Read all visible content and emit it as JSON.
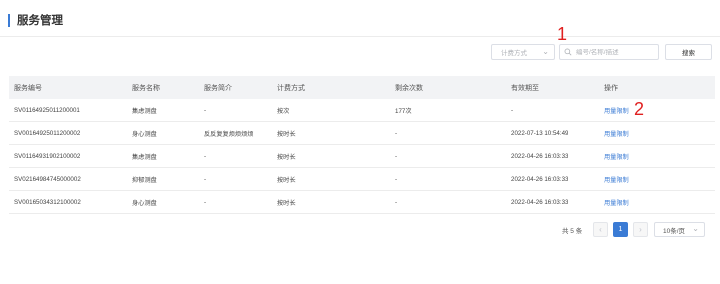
{
  "page": {
    "title": "服务管理"
  },
  "toolbar": {
    "billing_select": "计费方式",
    "search_placeholder": "编号/名称/描述",
    "search_button": "搜索"
  },
  "markers": [
    "1",
    "2"
  ],
  "table": {
    "headers": [
      "服务编号",
      "服务名称",
      "服务简介",
      "计费方式",
      "剩余次数",
      "有效期至",
      "操作"
    ],
    "rows": [
      [
        "SV01164925011200001",
        "集虑测盘",
        "-",
        "按次",
        "177次",
        "-",
        "用量限制"
      ],
      [
        "SV00164925011200002",
        "身心测盘",
        "反反复复烦烦烦烦",
        "按时长",
        "-",
        "2022-07-13 10:54:49",
        "用量限制"
      ],
      [
        "SV01164931902100002",
        "集虑测盘",
        "-",
        "按时长",
        "-",
        "2022-04-26 16:03:33",
        "用量限制"
      ],
      [
        "SV02164984745000002",
        "抑郁测盘",
        "-",
        "按时长",
        "-",
        "2022-04-26 16:03:33",
        "用量限制"
      ],
      [
        "SV00165034312100002",
        "身心测盘",
        "-",
        "按时长",
        "-",
        "2022-04-26 16:03:33",
        "用量限制"
      ]
    ]
  },
  "pagination": {
    "total": "共 5 条",
    "current_page": "1",
    "page_size": "10条/页"
  },
  "colors": {
    "accent": "#3a7bd5",
    "marker": "#e02020",
    "header_bg": "#f2f3f5"
  }
}
